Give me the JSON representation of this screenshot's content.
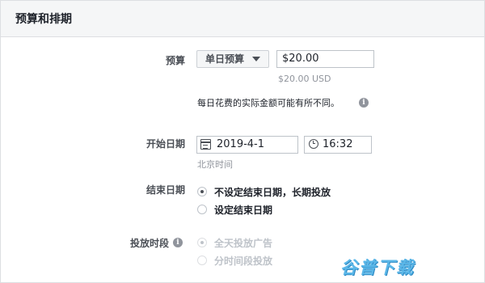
{
  "section": {
    "title": "预算和排期"
  },
  "budget": {
    "label": "预算",
    "type_dropdown": "单日预算",
    "amount_value": "$20.00",
    "amount_hint": "$20.00 USD",
    "note": "每日花费的实际金额可能有所不同。",
    "info_icon": "info-icon"
  },
  "start": {
    "label": "开始日期",
    "date_value": "2019-4-1",
    "time_value": "16:32",
    "timezone": "北京时间",
    "calendar_icon": "calendar-icon",
    "clock_icon": "clock-icon"
  },
  "end": {
    "label": "结束日期",
    "options": [
      {
        "label": "不设定结束日期，长期投放",
        "selected": true
      },
      {
        "label": "设定结束日期",
        "selected": false
      }
    ]
  },
  "schedule": {
    "label": "投放时段",
    "info_icon": "info-icon",
    "options": [
      {
        "label": "全天投放广告",
        "selected": true,
        "disabled": true
      },
      {
        "label": "分时间段投放",
        "selected": false,
        "disabled": true
      }
    ]
  },
  "watermark": {
    "text": "谷普下载"
  },
  "colors": {
    "header_bg": "#f5f6f7",
    "border": "#dddfe2",
    "watermark": "#5bb7e8"
  }
}
